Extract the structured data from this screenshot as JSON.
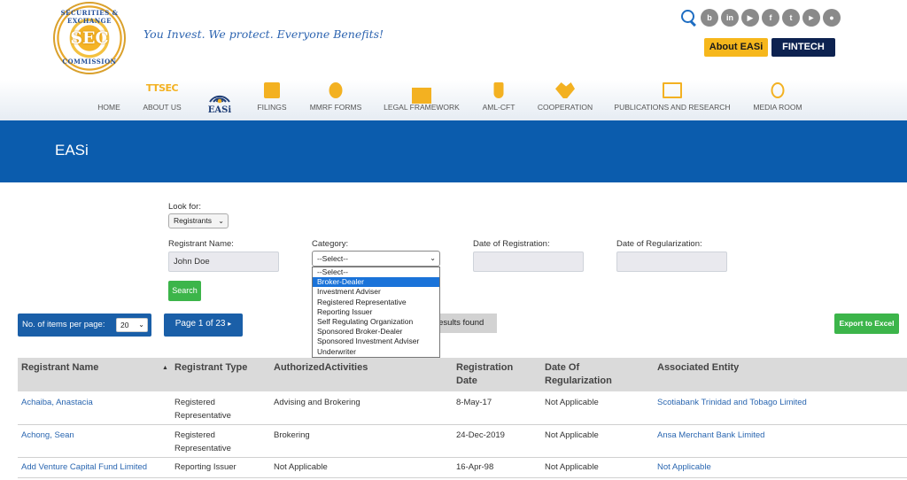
{
  "header": {
    "logo": {
      "ring_top": "SECURITIES & EXCHANGE",
      "center": "SEC",
      "ring_bottom": "COMMISSION"
    },
    "tagline": "You Invest. We protect. Everyone Benefits!",
    "social_icons": [
      "search-icon",
      "blog-icon",
      "linkedin-icon",
      "youtube-icon",
      "facebook-icon",
      "twitter-icon",
      "play-store-icon",
      "apple-icon"
    ],
    "about_easi": "About EASi",
    "fintech": "FINTECH",
    "accent_color": "#f6b71c",
    "navy_color": "#0d2250"
  },
  "nav": {
    "items": [
      {
        "label": "HOME"
      },
      {
        "label": "ABOUT US",
        "icon_text": "TTSEC"
      },
      {
        "label": "EASi"
      },
      {
        "label": "FILINGS"
      },
      {
        "label": "MMRF FORMS"
      },
      {
        "label": "LEGAL FRAMEWORK"
      },
      {
        "label": "AML-CFT"
      },
      {
        "label": "COOPERATION"
      },
      {
        "label": "PUBLICATIONS AND RESEARCH"
      },
      {
        "label": "MEDIA ROOM"
      }
    ]
  },
  "banner": {
    "title": "EASi",
    "color": "#0b5cad"
  },
  "form": {
    "look_for_label": "Look for:",
    "look_for_value": "Registrants",
    "registrant_name_label": "Registrant Name:",
    "registrant_name_value": "John Doe",
    "category_label": "Category:",
    "category_value": "--Select--",
    "category_options": [
      "--Select--",
      "Broker-Dealer",
      "Investment Adviser",
      "Registered Representative",
      "Reporting Issuer",
      "Self Regulating Organization",
      "Sponsored Broker-Dealer",
      "Sponsored Investment Adviser",
      "Underwriter"
    ],
    "category_highlighted": "Broker-Dealer",
    "date_registration_label": "Date of Registration:",
    "date_regularization_label": "Date of Regularization:",
    "search_button": "Search"
  },
  "controls": {
    "per_page_label": "No. of items per page:",
    "per_page_value": "20",
    "pager": "Page 1 of 23",
    "found": "3 results found",
    "export": "Export to Excel"
  },
  "table": {
    "headers": {
      "name": "Registrant Name",
      "type": "Registrant Type",
      "activities": "AuthorizedActivities",
      "reg_date_1": "Registration",
      "reg_date_2": "Date",
      "regularization_1": "Date Of",
      "regularization_2": "Regularization",
      "entity": "Associated Entity"
    },
    "rows": [
      {
        "name": "Achaiba, Anastacia",
        "type_1": "Registered",
        "type_2": "Representative",
        "activities": "Advising and Brokering",
        "reg_date": "8-May-17",
        "regularization": "Not Applicable",
        "entity": "Scotiabank Trinidad and Tobago Limited"
      },
      {
        "name": "Achong, Sean",
        "type_1": "Registered",
        "type_2": "Representative",
        "activities": "Brokering",
        "reg_date": "24-Dec-2019",
        "regularization": "Not Applicable",
        "entity": "Ansa Merchant Bank Limited"
      },
      {
        "name": "Add Venture Capital Fund Limited",
        "type_1": "Reporting Issuer",
        "type_2": "",
        "activities": "Not Applicable",
        "reg_date": "16-Apr-98",
        "regularization": "Not Applicable",
        "entity": "Not Applicable"
      }
    ]
  }
}
